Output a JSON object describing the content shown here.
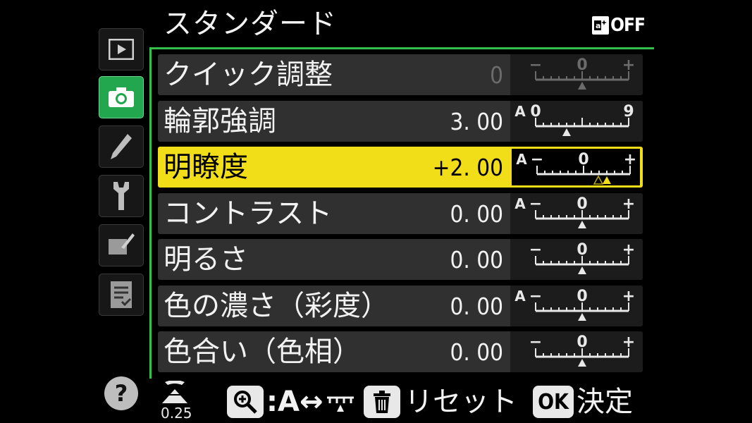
{
  "header": {
    "title": "スタンダード",
    "status_badge_text": "OFF"
  },
  "tabs": [
    {
      "name": "playback-menu",
      "icon": "play-icon",
      "active": false
    },
    {
      "name": "photo-shooting-menu",
      "icon": "camera-icon",
      "active": true
    },
    {
      "name": "custom-settings-menu",
      "icon": "pencil-icon",
      "active": false
    },
    {
      "name": "setup-menu",
      "icon": "wrench-icon",
      "active": false
    },
    {
      "name": "retouch-menu",
      "icon": "retouch-brush-icon",
      "active": false
    },
    {
      "name": "my-menu",
      "icon": "checklist-icon",
      "active": false
    }
  ],
  "menu": {
    "rows": [
      {
        "label": "クイック調整",
        "value": "0",
        "scale": {
          "auto_marker": false,
          "left_label": "−",
          "center_label": "0",
          "right_label": "+",
          "value_fraction": 0.5,
          "dim": true
        }
      },
      {
        "label": "輪郭強調",
        "value": "3. 00",
        "scale": {
          "auto_marker": true,
          "left_label": "0",
          "center_label": "",
          "right_label": "9",
          "value_fraction": 0.333,
          "dim": false
        }
      },
      {
        "label": "明瞭度",
        "value": "+2. 00",
        "selected": true,
        "scale": {
          "auto_marker": true,
          "left_label": "−",
          "center_label": "0",
          "right_label": "+",
          "value_fraction": 0.75,
          "dim": false
        }
      },
      {
        "label": "コントラスト",
        "value": "0. 00",
        "scale": {
          "auto_marker": true,
          "left_label": "−",
          "center_label": "0",
          "right_label": "+",
          "value_fraction": 0.5,
          "dim": false
        }
      },
      {
        "label": "明るさ",
        "value": "0. 00",
        "scale": {
          "auto_marker": false,
          "left_label": "−",
          "center_label": "0",
          "right_label": "+",
          "value_fraction": 0.5,
          "dim": false
        }
      },
      {
        "label": "色の濃さ（彩度）",
        "value": "0. 00",
        "scale": {
          "auto_marker": true,
          "left_label": "−",
          "center_label": "0",
          "right_label": "+",
          "value_fraction": 0.5,
          "dim": false
        }
      },
      {
        "label": "色合い（色相）",
        "value": "0. 00",
        "scale": {
          "auto_marker": false,
          "left_label": "−",
          "center_label": "0",
          "right_label": "+",
          "value_fraction": 0.5,
          "dim": false
        }
      }
    ]
  },
  "footer": {
    "step_value": "0.25",
    "zoom_hint_text": ":A↔",
    "reset_label": "リセット",
    "ok_icon_text": "OK",
    "ok_label": "決定"
  },
  "help": {
    "text": "?"
  },
  "colors": {
    "accent_green": "#22a64e",
    "frame_green": "#35c04c",
    "highlight_yellow": "#f1dd18"
  }
}
